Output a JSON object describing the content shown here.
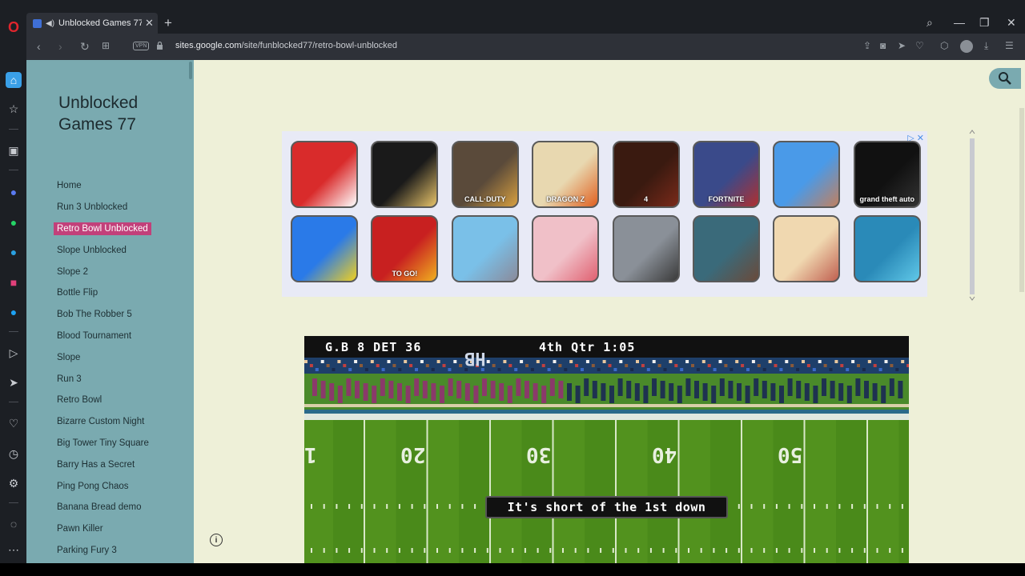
{
  "tab": {
    "title": "Unblocked Games 77 -"
  },
  "address": {
    "vpn": "VPN",
    "url_domain": "sites.google.com",
    "url_path": "/site/funblocked77/retro-bowl-unblocked"
  },
  "site": {
    "title": "Unblocked Games 77"
  },
  "nav": [
    "Home",
    "Run 3 Unblocked",
    "Retro Bowl Unblocked",
    "Slope Unblocked",
    "Slope 2",
    "Bottle Flip",
    "Bob The Robber 5",
    "Blood Tournament",
    "Slope",
    "Run 3",
    "Retro Bowl",
    "Bizarre Custom Night",
    "Big Tower Tiny Square",
    "Barry Has a Secret",
    "Ping Pong Chaos",
    "Banana Bread demo",
    "Pawn Killer",
    "Parking Fury 3"
  ],
  "nav_active_index": 2,
  "ad": {
    "row1": [
      {
        "name": "angry-birds",
        "label": "",
        "bg": "#d92b2b",
        "bg2": "#ffffff"
      },
      {
        "name": "bendy",
        "label": "",
        "bg": "#1a1a1a",
        "bg2": "#e8c46a"
      },
      {
        "name": "call-of-duty",
        "label": "CALL·DUTY",
        "bg": "#5a4a3a",
        "bg2": "#d8a040"
      },
      {
        "name": "dragon-ball",
        "label": "DRAGON Z",
        "bg": "#e8d8b0",
        "bg2": "#e06020"
      },
      {
        "name": "fnaf-4",
        "label": "4",
        "bg": "#3a1a10",
        "bg2": "#7a2a1a"
      },
      {
        "name": "fortnite",
        "label": "FORTNITE",
        "bg": "#3a4a8a",
        "bg2": "#b03030"
      },
      {
        "name": "getting-over-it",
        "label": "",
        "bg": "#4a9ae8",
        "bg2": "#c08060"
      },
      {
        "name": "gta-san-andreas",
        "label": "grand theft auto",
        "bg": "#111111",
        "bg2": "#333333"
      }
    ],
    "row2": [
      {
        "name": "crowd-city",
        "label": "",
        "bg": "#2a7ae8",
        "bg2": "#f0d020"
      },
      {
        "name": "to-go",
        "label": "TO GO!",
        "bg": "#c82020",
        "bg2": "#f0b020"
      },
      {
        "name": "talking-tom",
        "label": "",
        "bg": "#7ac0e8",
        "bg2": "#8a8a9a"
      },
      {
        "name": "anime-girl-pink",
        "label": "",
        "bg": "#f0c0c8",
        "bg2": "#e06070"
      },
      {
        "name": "survival-game",
        "label": "",
        "bg": "#8a9098",
        "bg2": "#3a3a3a"
      },
      {
        "name": "arknights",
        "label": "",
        "bg": "#3a6a7a",
        "bg2": "#6a4a3a"
      },
      {
        "name": "anime-girl-blonde",
        "label": "",
        "bg": "#f0d8b0",
        "bg2": "#c06050"
      },
      {
        "name": "jinx",
        "label": "",
        "bg": "#2a8ab8",
        "bg2": "#60c8e8"
      }
    ]
  },
  "game": {
    "score": "G.B 8  DET 36",
    "clock": "4th Qtr  1:05",
    "yards": [
      "1",
      "20",
      "30",
      "40",
      "50"
    ],
    "endzone": "HB",
    "caption": "It's short of the 1st down"
  },
  "colors": {
    "sidebar": "#7aaab0",
    "page": "#eef0d8",
    "active_nav": "#c2407a",
    "field": "#4a8a1a"
  }
}
